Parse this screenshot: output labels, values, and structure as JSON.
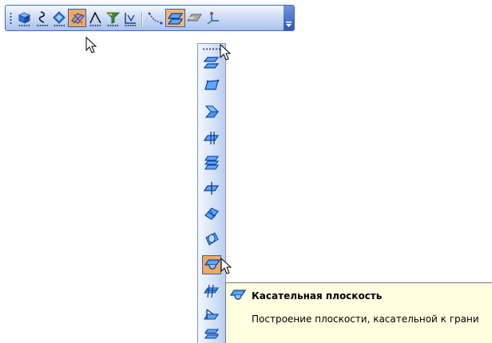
{
  "toolbar": {
    "buttons": [
      {
        "id": "solid-cube",
        "icon": "cube-icon"
      },
      {
        "id": "spline",
        "icon": "spline-curve-icon"
      },
      {
        "id": "surface-diamond",
        "icon": "surface-diamond-icon"
      },
      {
        "id": "point-on-plane",
        "icon": "point-on-plane-icon",
        "state": "pressed"
      },
      {
        "id": "angle-line",
        "icon": "angle-line-icon"
      },
      {
        "id": "filter",
        "icon": "funnel-filter-icon"
      },
      {
        "id": "dimension",
        "icon": "dimension-icon"
      },
      {
        "id": "curve-line",
        "icon": "dashed-curve-icon"
      },
      {
        "id": "auxiliary-plane",
        "icon": "plane-icon",
        "state": "hot"
      },
      {
        "id": "solid-plane",
        "icon": "gray-plane-icon"
      },
      {
        "id": "coordinate-system",
        "icon": "axes-icon"
      }
    ],
    "overflow_icon": "chevron-down-icon"
  },
  "dropdown": {
    "items": [
      {
        "id": "offset-plane",
        "icon": "offset-plane-icon"
      },
      {
        "id": "plane-three-points",
        "icon": "plane-three-points-icon"
      },
      {
        "id": "plane-at-angle",
        "icon": "plane-at-angle-icon"
      },
      {
        "id": "plane-through-edge",
        "icon": "plane-through-edge-icon"
      },
      {
        "id": "plane-normal",
        "icon": "plane-normal-icon"
      },
      {
        "id": "plane-midway",
        "icon": "plane-midway-icon"
      },
      {
        "id": "plane-through-point",
        "icon": "plane-through-point-icon"
      },
      {
        "id": "plane-cylinder",
        "icon": "plane-cylinder-icon"
      },
      {
        "id": "tangent-plane",
        "icon": "tangent-plane-icon",
        "state": "hot"
      },
      {
        "id": "plane-perpendicular",
        "icon": "plane-perpendicular-icon"
      },
      {
        "id": "plane-edge-vertex",
        "icon": "plane-edge-vertex-icon"
      },
      {
        "id": "plane-parallel",
        "icon": "plane-parallel-icon"
      }
    ]
  },
  "tooltip": {
    "icon": "tangent-plane-icon",
    "title": "Касательная плоскость",
    "description": "Построение плоскости, касательной к грани"
  },
  "colors": {
    "toolbar_border": "#3c6bc4",
    "hot_button": "#f0a860",
    "tooltip_bg": "#ffffe1",
    "icon_blue": "#2f6fd8"
  }
}
